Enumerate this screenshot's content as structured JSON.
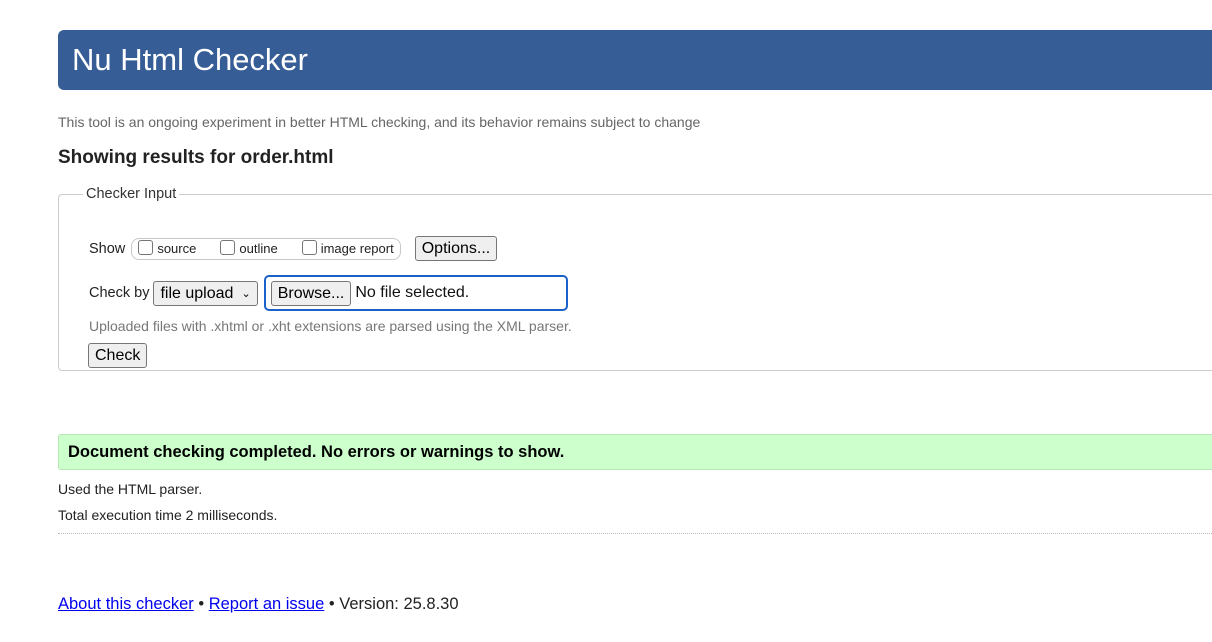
{
  "header": {
    "title": "Nu Html Checker"
  },
  "tagline": "This tool is an ongoing experiment in better HTML checking, and its behavior remains subject to change",
  "results_heading": "Showing results for order.html",
  "checker_input": {
    "legend": "Checker Input",
    "show_label": "Show",
    "show_options": [
      {
        "label": "source",
        "checked": false
      },
      {
        "label": "outline",
        "checked": false
      },
      {
        "label": "image report",
        "checked": false
      }
    ],
    "options_button": "Options...",
    "check_by_label": "Check by",
    "check_by_selected": "file upload",
    "browse_button": "Browse...",
    "file_status": "No file selected.",
    "hint": "Uploaded files with .xhtml or .xht extensions are parsed using the XML parser.",
    "check_button": "Check"
  },
  "result": {
    "success_message": "Document checking completed. No errors or warnings to show.",
    "parser_info": "Used the HTML parser.",
    "execution_time": "Total execution time 2 milliseconds."
  },
  "footer": {
    "about_link": "About this checker",
    "separator": "•",
    "report_link": "Report an issue",
    "version": "Version: 25.8.30"
  },
  "colors": {
    "header_bg": "#365d95",
    "success_bg": "#ccffcc",
    "link": "#0000ee",
    "focus_ring": "#1a62c9"
  }
}
